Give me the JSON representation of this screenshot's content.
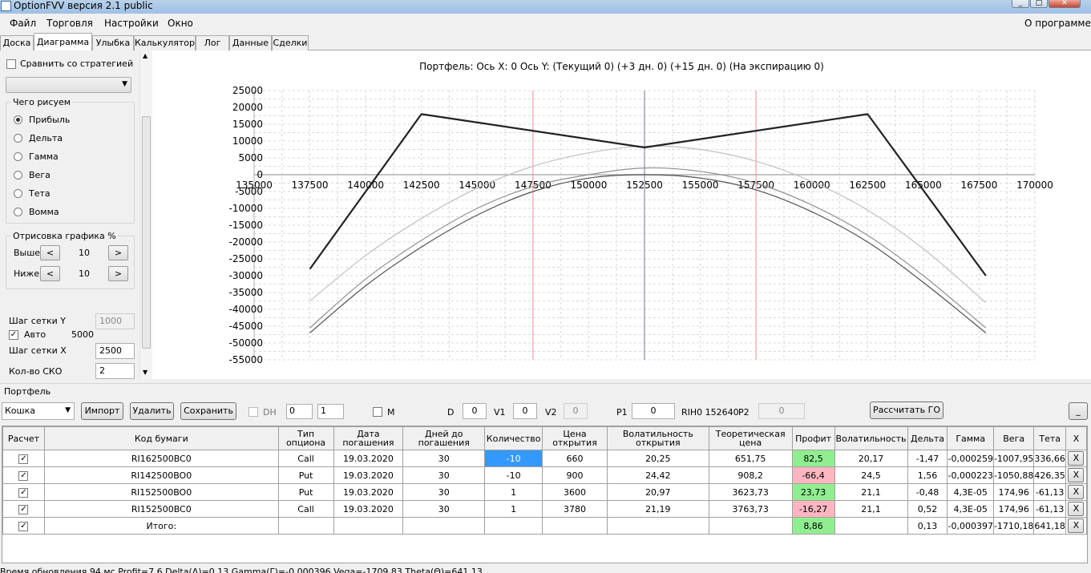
{
  "window": {
    "title": "OptionFVV версия 2.1 public",
    "min": "_",
    "max": "□",
    "close": "✕"
  },
  "menu": {
    "file": "Файл",
    "trade": "Торговля",
    "settings": "Настройки",
    "window": "Окно",
    "about": "О программе"
  },
  "tabs": [
    "Доска",
    "Диаграмма",
    "Улыбка",
    "Калькулятор",
    "Лог",
    "Данные",
    "Сделки"
  ],
  "left": {
    "compare_label": "Сравнить со стратегией",
    "draw_group": "Чего рисуем",
    "radios": [
      "Прибыль",
      "Дельта",
      "Гамма",
      "Вега",
      "Тета",
      "Вомма"
    ],
    "render_group": "Отрисовка графика %",
    "above_label": "Выше",
    "above_val": "10",
    "below_label": "Ниже",
    "below_val": "10",
    "prev": "<",
    "next": ">",
    "grid_y_label": "Шаг сетки Y",
    "grid_y_val": "1000",
    "auto_label": "Авто",
    "auto_val": "5000",
    "grid_x_label": "Шаг сетки X",
    "grid_x_val": "2500",
    "sko_label": "Кол-во СКО",
    "sko_val": "2"
  },
  "chart_title": "Портфель: Ось X: 0 Ось Y:  (Текущий 0)  (+3 дн. 0)  (+15 дн. 0)  (На экспирацию 0)",
  "chart_data": {
    "type": "line",
    "title": "Портфель: Ось X: 0 Ось Y:  (Текущий 0)  (+3 дн. 0)  (+15 дн. 0)  (На экспирацию 0)",
    "xlim": [
      135000,
      170000
    ],
    "ylim": [
      -55000,
      25000
    ],
    "x_ticks": [
      135000,
      137500,
      140000,
      142500,
      145000,
      147500,
      150000,
      152500,
      155000,
      157500,
      160000,
      162500,
      165000,
      167500,
      170000
    ],
    "y_ticks": [
      25000,
      20000,
      15000,
      10000,
      5000,
      0,
      -5000,
      -10000,
      -15000,
      -20000,
      -25000,
      -30000,
      -35000,
      -40000,
      -45000,
      -50000,
      -55000
    ],
    "grid": true,
    "vlines": [
      {
        "x": 147500,
        "color": "#f4a0b0"
      },
      {
        "x": 152500,
        "color": "#8888aa"
      },
      {
        "x": 157500,
        "color": "#f4a0b0"
      }
    ],
    "series": [
      {
        "color": "#222222",
        "width": 2.2,
        "x": [
          137500,
          142500,
          152500,
          162500,
          167800
        ],
        "y": [
          -28000,
          18000,
          8100,
          18000,
          -30000
        ]
      },
      {
        "color": "#c0c0c0",
        "width": 1.2,
        "x": [
          137500,
          140000,
          142500,
          145000,
          147500,
          150000,
          152500,
          155000,
          157500,
          160000,
          162500,
          165000,
          167800
        ],
        "y": [
          -37500,
          -24000,
          -13000,
          -4000,
          2500,
          6500,
          8500,
          7500,
          4000,
          -2000,
          -10500,
          -22000,
          -38000
        ]
      },
      {
        "color": "#909090",
        "width": 1.2,
        "x": [
          137500,
          140000,
          142500,
          145000,
          147500,
          150000,
          152500,
          155000,
          157500,
          160000,
          162500,
          165000,
          167800
        ],
        "y": [
          -45500,
          -31000,
          -19500,
          -10000,
          -3500,
          0,
          2000,
          1000,
          -2500,
          -9000,
          -18000,
          -30000,
          -45500
        ]
      },
      {
        "color": "#505050",
        "width": 1.2,
        "x": [
          137500,
          140000,
          142500,
          145000,
          147500,
          150000,
          152500,
          155000,
          157500,
          160000,
          162500,
          165000,
          167800
        ],
        "y": [
          -47000,
          -33000,
          -21500,
          -12000,
          -5000,
          -1000,
          0,
          -1000,
          -4500,
          -11000,
          -20000,
          -32000,
          -47000
        ]
      }
    ]
  },
  "portfolio": {
    "group_label": "Портфель",
    "selected": "Кошка",
    "import": "Импорт",
    "delete": "Удалить",
    "save": "Сохранить",
    "dh": "DH",
    "dh_a": "0",
    "dh_b": "1",
    "m": "M",
    "d_label": "D",
    "d_val": "0",
    "v1_label": "V1",
    "v1_val": "0",
    "v2_label": "V2",
    "v2_val": "0",
    "p1_label": "P1",
    "p1_val": "0",
    "rih": "RIH0 152640",
    "p2_label": "P2",
    "p2_val": "0",
    "calc_go": "Рассчитать ГО",
    "collapse": "_"
  },
  "table": {
    "headers": [
      "Расчет",
      "Код бумаги",
      "Тип опциона",
      "Дата погашения",
      "Дней до погашения",
      "Количество",
      "Цена открытия",
      "Волатильность открытия",
      "Теоретическая цена",
      "Профит",
      "Волатильность",
      "Дельта",
      "Гамма",
      "Вега",
      "Тета",
      "X"
    ],
    "rows": [
      {
        "code": "RI162500BC0",
        "type": "Call",
        "date": "19.03.2020",
        "days": "30",
        "qty": "-10",
        "price": "660",
        "vol_open": "20,25",
        "theo": "651,75",
        "profit": "82,5",
        "vol": "20,17",
        "delta": "-1,47",
        "gamma": "-0,000259",
        "vega": "-1007,95",
        "theta": "336,66"
      },
      {
        "code": "RI142500BO0",
        "type": "Put",
        "date": "19.03.2020",
        "days": "30",
        "qty": "-10",
        "price": "900",
        "vol_open": "24,42",
        "theo": "908,2",
        "profit": "-66,4",
        "vol": "24,5",
        "delta": "1,56",
        "gamma": "-0,000223",
        "vega": "-1050,88",
        "theta": "426,35"
      },
      {
        "code": "RI152500BO0",
        "type": "Put",
        "date": "19.03.2020",
        "days": "30",
        "qty": "1",
        "price": "3600",
        "vol_open": "20,97",
        "theo": "3623,73",
        "profit": "23,73",
        "vol": "21,1",
        "delta": "-0,48",
        "gamma": "4,3E-05",
        "vega": "174,96",
        "theta": "-61,13"
      },
      {
        "code": "RI152500BC0",
        "type": "Call",
        "date": "19.03.2020",
        "days": "30",
        "qty": "1",
        "price": "3780",
        "vol_open": "21,19",
        "theo": "3763,73",
        "profit": "-16,27",
        "vol": "21,1",
        "delta": "0,52",
        "gamma": "4,3E-05",
        "vega": "174,96",
        "theta": "-61,13"
      }
    ],
    "total": {
      "label": "Итого:",
      "profit": "8,86",
      "delta": "0,13",
      "gamma": "-0,000397",
      "vega": "-1710,18",
      "theta": "641,18"
    }
  },
  "status": "Время обновления 94 мс  Profit=7,6 Delta(Δ)=0,13 Gamma(Γ)=-0,000396 Vega=-1709,83 Theta(Θ)=641,13"
}
